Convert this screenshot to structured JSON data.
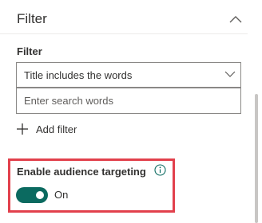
{
  "section": {
    "title": "Filter",
    "chevron_icon": "chevron-up-icon"
  },
  "filter": {
    "label": "Filter",
    "dropdown_value": "Title includes the words",
    "dropdown_icon": "chevron-down-icon",
    "search_placeholder": "Enter search words",
    "search_value": "",
    "add_filter_label": "Add filter",
    "add_icon": "plus-icon"
  },
  "audience_targeting": {
    "label": "Enable audience targeting",
    "info_icon": "info-icon",
    "toggle_state": "On",
    "toggle_on": true,
    "highlight_color": "#e2404c"
  },
  "colors": {
    "accent": "#0b6a60",
    "text": "#323130",
    "border": "#8a8886"
  }
}
